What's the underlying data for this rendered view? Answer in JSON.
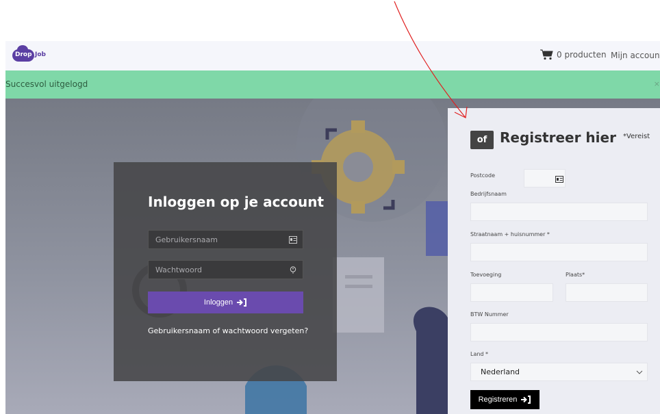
{
  "nav": {
    "logo_drop": "Drop",
    "logo_job": "Job",
    "cart_label": "0 producten",
    "account_label": "Mijn account"
  },
  "alert": {
    "message": "Succesvol uitgelogd",
    "close": "×"
  },
  "login": {
    "title": "Inloggen op je account",
    "username_placeholder": "Gebruikersnaam",
    "password_placeholder": "Wachtwoord",
    "button_label": "Inloggen",
    "forgot_link": "Gebruikersnaam of wachtwoord vergeten?"
  },
  "register": {
    "badge": "of",
    "title": "Registreer hier",
    "required_note": "*Vereist",
    "postcode_label": "Postcode",
    "company_label": "Bedrijfsnaam",
    "street_label": "Straatnaam + huisnummer *",
    "addition_label": "Toevoeging",
    "city_label": "Plaats*",
    "vat_label": "BTW Nummer",
    "country_label": "Land *",
    "country_value": "Nederland",
    "button_label": "Registreren"
  },
  "colors": {
    "brand": "#5b3fa3",
    "success_banner": "#7fd8a8",
    "login_button": "#6a4bae",
    "annotation_arrow": "#e02020"
  },
  "icons": [
    "cart-icon",
    "id-card-icon",
    "key-icon",
    "sign-in-icon",
    "chevron-down-icon"
  ]
}
